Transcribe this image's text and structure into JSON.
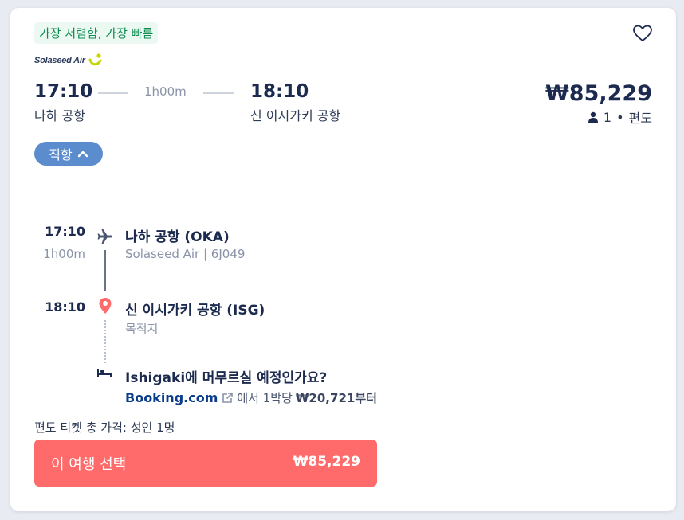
{
  "badge": "가장 저렴함, 가장 빠름",
  "airline": {
    "name": "Solaseed Air"
  },
  "summary": {
    "depart_time": "17:10",
    "depart_airport": "나하 공항",
    "duration": "1h00m",
    "arrive_time": "18:10",
    "arrive_airport": "신 이시가키 공항",
    "price": "₩85,229",
    "passengers": "1",
    "trip_type": "편도"
  },
  "stops_toggle": {
    "label": "직항"
  },
  "segment": {
    "depart_time": "17:10",
    "duration": "1h00m",
    "depart_airport": "나하 공항 (OKA)",
    "flight_info": "Solaseed Air | 6J049",
    "arrive_time": "18:10",
    "arrive_airport": "신 이시가키 공항 (ISG)",
    "destination_label": "목적지"
  },
  "hotel": {
    "question": "Ishigaki에 머무르실 예정인가요?",
    "provider": "Booking.com",
    "from_text": "에서 1박당",
    "price": "₩20,721",
    "suffix": "부터"
  },
  "total_label": "편도 티켓 총 가격: 성인 1명",
  "select_button": {
    "label": "이 여행 선택",
    "price": "₩85,229"
  },
  "colors": {
    "accent": "#ff6b6b",
    "badge_green": "#0c8c4e",
    "stops_blue": "#5b8dce",
    "navy": "#1b2a4e",
    "booking_blue": "#0b3c8a",
    "logo_yellow": "#c7d400"
  },
  "icons": [
    "heart-icon",
    "person-icon",
    "chevron-up-icon",
    "plane-icon",
    "location-pin-icon",
    "bed-icon",
    "external-link-icon"
  ]
}
